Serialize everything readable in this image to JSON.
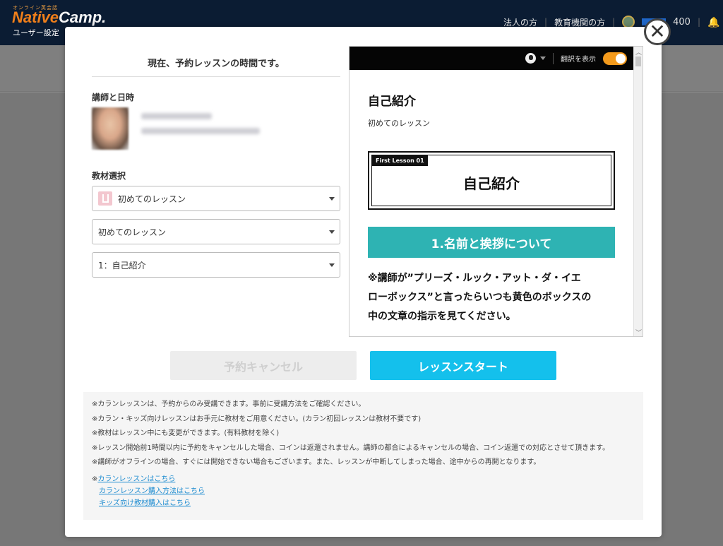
{
  "header": {
    "logo_sub": "オンライン英会話",
    "logo_native": "Native",
    "logo_camp": "Camp.",
    "user_settings": "ユーザー設定",
    "nav": [
      "法人の方",
      "教育機関の方"
    ],
    "coins": "400"
  },
  "modal": {
    "close_symbol": "✕",
    "current_lesson": "現在、予約レッスンの時間です。",
    "teacher_label": "講師と日時",
    "material_label": "教材選択",
    "selects": {
      "category": "初めてのレッスン",
      "course": "初めてのレッスン",
      "lesson": "1：自己紹介"
    },
    "preview": {
      "translate_label": "翻訳を表示",
      "title": "自己紹介",
      "subtitle": "初めてのレッスン",
      "card_tag": "First Lesson 01",
      "card_title": "自己紹介",
      "banner": "1.名前と挨拶について",
      "note_line1": "※講師が”プリーズ・ルック・アット・ダ・イエ",
      "note_line2": "ローボックス”と言ったらいつも黄色のボックスの",
      "note_line3": "中の文章の指示を見てください。"
    },
    "buttons": {
      "cancel": "予約キャンセル",
      "start": "レッスンスタート"
    },
    "notes": [
      "※カランレッスンは、予約からのみ受講できます。事前に受講方法をご確認ください。",
      "※カラン・キッズ向けレッスンはお手元に教材をご用意ください。(カラン初回レッスンは教材不要です)",
      "※教材はレッスン中にも変更ができます。(有料教材を除く)",
      "※レッスン開始前1時間以内に予約をキャンセルした場合、コインは返還されません。講師の都合によるキャンセルの場合、コイン返還での対応とさせて頂きます。",
      "※講師がオフラインの場合、すぐには開始できない場合もございます。また、レッスンが中断してしまった場合、途中からの再開となります。"
    ],
    "links_prefix": "※",
    "links": [
      "カランレッスンはこちら",
      "カランレッスン購入方法はこちら",
      "キッズ向け教材購入はこちら"
    ]
  },
  "colors": {
    "header_bg": "#0b1c33",
    "accent_orange": "#f07f1a",
    "start_button": "#14c0ec",
    "teal_banner": "#2eb3b3",
    "toggle_on": "#f39a1c",
    "link": "#1c8bd0"
  },
  "icons": [
    "close-icon",
    "globe-icon",
    "bell-icon",
    "book-icon",
    "caret-down-icon"
  ]
}
